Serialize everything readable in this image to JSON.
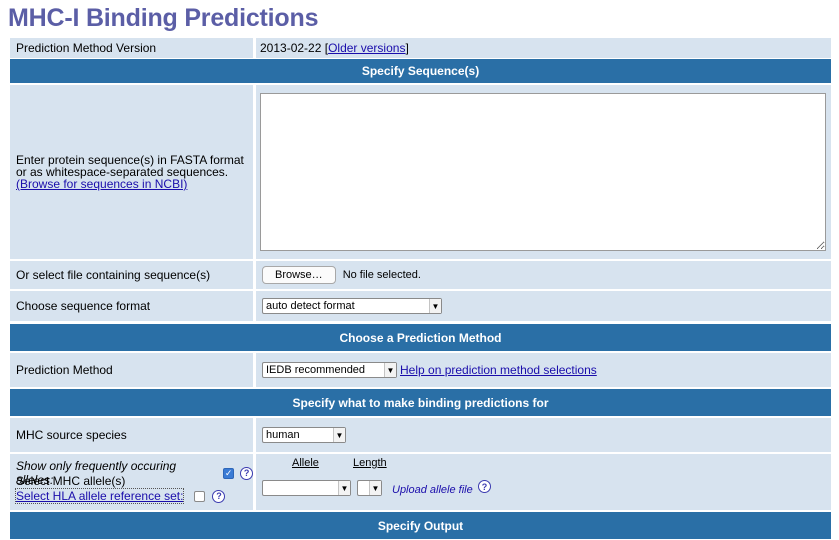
{
  "page": {
    "title": "MHC-I Binding Predictions"
  },
  "version": {
    "label": "Prediction Method Version",
    "value": "2013-02-22",
    "bracket_open": "[",
    "link": "Older versions",
    "bracket_close": "]"
  },
  "sections": {
    "sequence": "Specify Sequence(s)",
    "method": "Choose a Prediction Method",
    "target": "Specify what to make binding predictions for",
    "output": "Specify Output"
  },
  "sequence": {
    "instruction_line1": "Enter protein sequence(s) in FASTA format",
    "instruction_line2": "or as whitespace-separated sequences.",
    "ncbi_link": "(Browse for sequences in NCBI)",
    "textarea_value": "",
    "file_label": "Or select file containing sequence(s)",
    "browse_label": "Browse…",
    "file_status": "No file selected.",
    "format_label": "Choose sequence format",
    "format_value": "auto detect format"
  },
  "method": {
    "label": "Prediction Method",
    "value": "IEDB recommended",
    "help_link": "Help on prediction method selections"
  },
  "target": {
    "species_label": "MHC source species",
    "species_value": "human",
    "frequent_label": "Show only frequently occuring alleles:",
    "frequent_checked": true,
    "select_alleles_label": "Select MHC allele(s)",
    "reference_set_link": "Select HLA allele reference set:",
    "reference_set_checked": false,
    "allele_header": "Allele",
    "length_header": "Length",
    "allele_value": "",
    "length_value": "",
    "upload_link": "Upload allele file"
  },
  "icons": {
    "help": "?",
    "checkmark": "✓",
    "dropdown": "▼"
  },
  "colors": {
    "title": "#5b5ea6",
    "section_bar": "#2a6fa6",
    "cell_bg": "#d7e3ef",
    "link": "#1a0dab",
    "checkbox": "#3a7bd5"
  }
}
